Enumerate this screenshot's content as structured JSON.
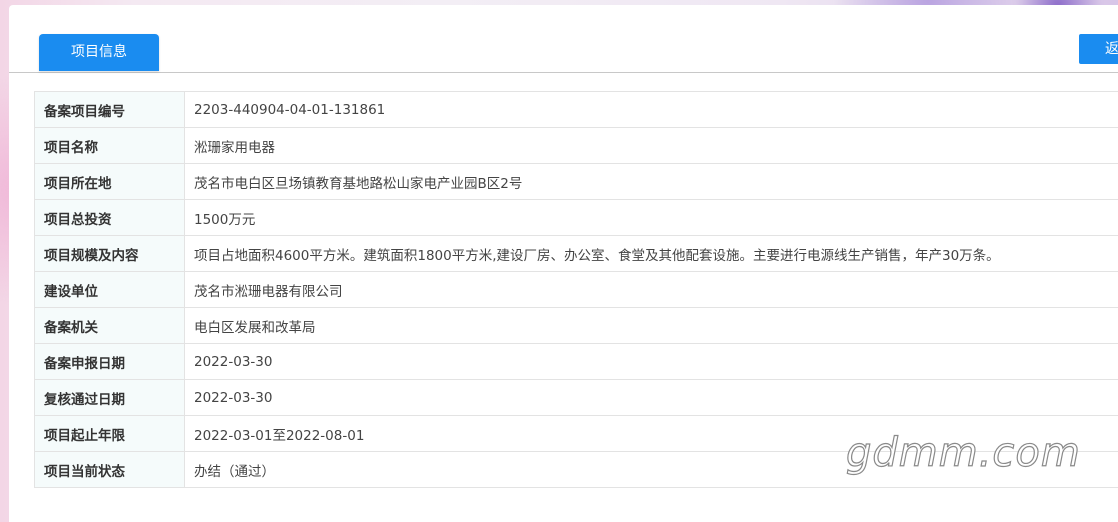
{
  "tab": {
    "label": "项目信息"
  },
  "back_button": {
    "label": "返回"
  },
  "rows": [
    {
      "label": "备案项目编号",
      "value": "2203-440904-04-01-131861"
    },
    {
      "label": "项目名称",
      "value": "淞珊家用电器"
    },
    {
      "label": "项目所在地",
      "value": "茂名市电白区旦场镇教育基地路松山家电产业园B区2号"
    },
    {
      "label": "项目总投资",
      "value": "1500万元"
    },
    {
      "label": "项目规模及内容",
      "value": "项目占地面积4600平方米。建筑面积1800平方米,建设厂房、办公室、食堂及其他配套设施。主要进行电源线生产销售，年产30万条。"
    },
    {
      "label": "建设单位",
      "value": "茂名市淞珊电器有限公司"
    },
    {
      "label": "备案机关",
      "value": "电白区发展和改革局"
    },
    {
      "label": "备案申报日期",
      "value": "2022-03-30"
    },
    {
      "label": "复核通过日期",
      "value": "2022-03-30"
    },
    {
      "label": "项目起止年限",
      "value": "2022-03-01至2022-08-01"
    },
    {
      "label": "项目当前状态",
      "value": "办结（通过）"
    }
  ],
  "watermark": {
    "text": "gdmm.com"
  },
  "colors": {
    "accent": "#1a8cf0",
    "label_bg": "#f5fbfb",
    "border": "#e3e3e3"
  }
}
